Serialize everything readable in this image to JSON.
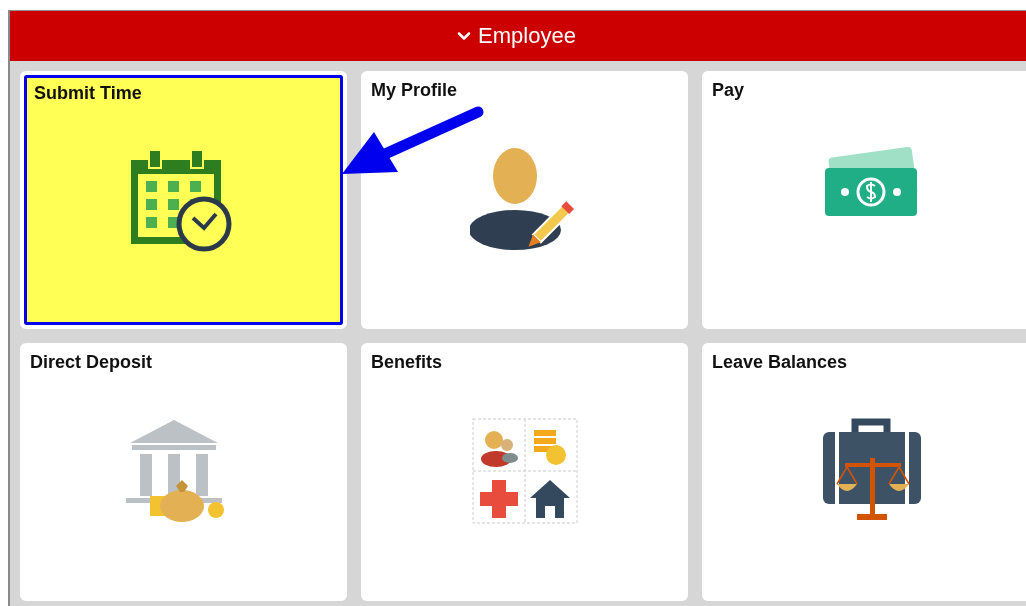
{
  "header": {
    "title": "Employee"
  },
  "tiles": [
    {
      "title": "Submit Time",
      "selected": true
    },
    {
      "title": "My Profile",
      "selected": false
    },
    {
      "title": "Pay",
      "selected": false
    },
    {
      "title": "Direct Deposit",
      "selected": false
    },
    {
      "title": "Benefits",
      "selected": false
    },
    {
      "title": "Leave Balances",
      "selected": false
    }
  ]
}
